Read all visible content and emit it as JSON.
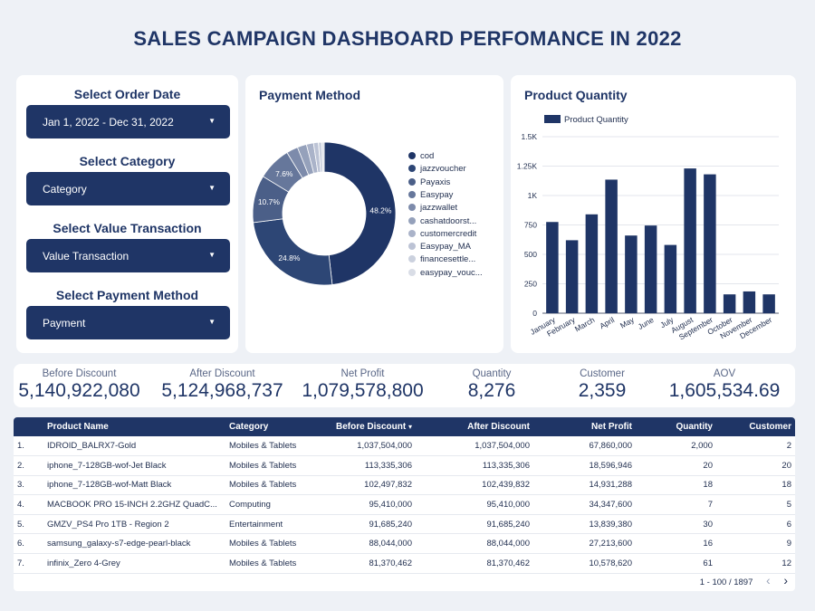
{
  "title": "SALES CAMPAIGN DASHBOARD PERFOMANCE IN 2022",
  "filters": [
    {
      "label": "Select Order Date",
      "value": "Jan 1, 2022 - Dec 31, 2022"
    },
    {
      "label": "Select Category",
      "value": "Category"
    },
    {
      "label": "Select Value Transaction",
      "value": "Value Transaction"
    },
    {
      "label": "Select Payment Method",
      "value": "Payment"
    }
  ],
  "chart_data": [
    {
      "type": "pie",
      "title": "Payment Method",
      "categories": [
        "cod",
        "jazzvoucher",
        "Payaxis",
        "Easypay",
        "jazzwallet",
        "cashatdoorst...",
        "customercredit",
        "Easypay_MA",
        "financesettle...",
        "easypay_vouc..."
      ],
      "values": [
        48.2,
        24.8,
        10.7,
        7.6,
        2.6,
        2.1,
        1.6,
        1.1,
        0.8,
        0.5
      ],
      "data_labels": [
        "48.2%",
        "24.8%",
        "10.7%",
        "7.6%"
      ],
      "colors": [
        "#1f3566",
        "#2d4675",
        "#4b5f88",
        "#66779b",
        "#7d8bab",
        "#95a1bb",
        "#aab3c9",
        "#bcc3d5",
        "#cbd1de",
        "#d9dde6"
      ],
      "donut": true,
      "legend_position": "right"
    },
    {
      "type": "bar",
      "title": "Product Quantity",
      "categories": [
        "January",
        "February",
        "March",
        "April",
        "May",
        "June",
        "July",
        "August",
        "September",
        "October",
        "November",
        "December"
      ],
      "series": [
        {
          "name": "Product Quantity",
          "values": [
            775,
            620,
            840,
            1135,
            660,
            745,
            580,
            1230,
            1180,
            160,
            185,
            160
          ]
        }
      ],
      "ylim": [
        0,
        1500
      ],
      "yticks": [
        0,
        250,
        500,
        750,
        1000,
        1250,
        1500
      ],
      "yticklabels": [
        "0",
        "250",
        "500",
        "750",
        "1K",
        "1.25K",
        "1.5K"
      ],
      "grid": true,
      "legend_position": "top-left",
      "color": "#1f3566"
    }
  ],
  "kpis": [
    {
      "label": "Before Discount",
      "value": "5,140,922,080"
    },
    {
      "label": "After Discount",
      "value": "5,124,968,737"
    },
    {
      "label": "Net Profit",
      "value": "1,079,578,800"
    },
    {
      "label": "Quantity",
      "value": "8,276"
    },
    {
      "label": "Customer",
      "value": "2,359"
    },
    {
      "label": "AOV",
      "value": "1,605,534.69"
    }
  ],
  "table": {
    "columns": [
      "",
      "Product Name",
      "Category",
      "Before Discount",
      "After Discount",
      "Net Profit",
      "Quantity",
      "Customer"
    ],
    "sort_indicator": "▾",
    "rows": [
      [
        "1.",
        "IDROID_BALRX7-Gold",
        "Mobiles & Tablets",
        "1,037,504,000",
        "1,037,504,000",
        "67,860,000",
        "2,000",
        "2"
      ],
      [
        "2.",
        "iphone_7-128GB-wof-Jet Black",
        "Mobiles & Tablets",
        "113,335,306",
        "113,335,306",
        "18,596,946",
        "20",
        "20"
      ],
      [
        "3.",
        "iphone_7-128GB-wof-Matt Black",
        "Mobiles & Tablets",
        "102,497,832",
        "102,439,832",
        "14,931,288",
        "18",
        "18"
      ],
      [
        "4.",
        "MACBOOK PRO 15-INCH 2.2GHZ QuadC...",
        "Computing",
        "95,410,000",
        "95,410,000",
        "34,347,600",
        "7",
        "5"
      ],
      [
        "5.",
        "GMZV_PS4 Pro 1TB - Region 2",
        "Entertainment",
        "91,685,240",
        "91,685,240",
        "13,839,380",
        "30",
        "6"
      ],
      [
        "6.",
        "samsung_galaxy-s7-edge-pearl-black",
        "Mobiles & Tablets",
        "88,044,000",
        "88,044,000",
        "27,213,600",
        "16",
        "9"
      ],
      [
        "7.",
        "infinix_Zero 4-Grey",
        "Mobiles & Tablets",
        "81,370,462",
        "81,370,462",
        "10,578,620",
        "61",
        "12"
      ]
    ],
    "pagination": "1 - 100 / 1897",
    "prev_icon": "‹",
    "next_icon": "›"
  }
}
